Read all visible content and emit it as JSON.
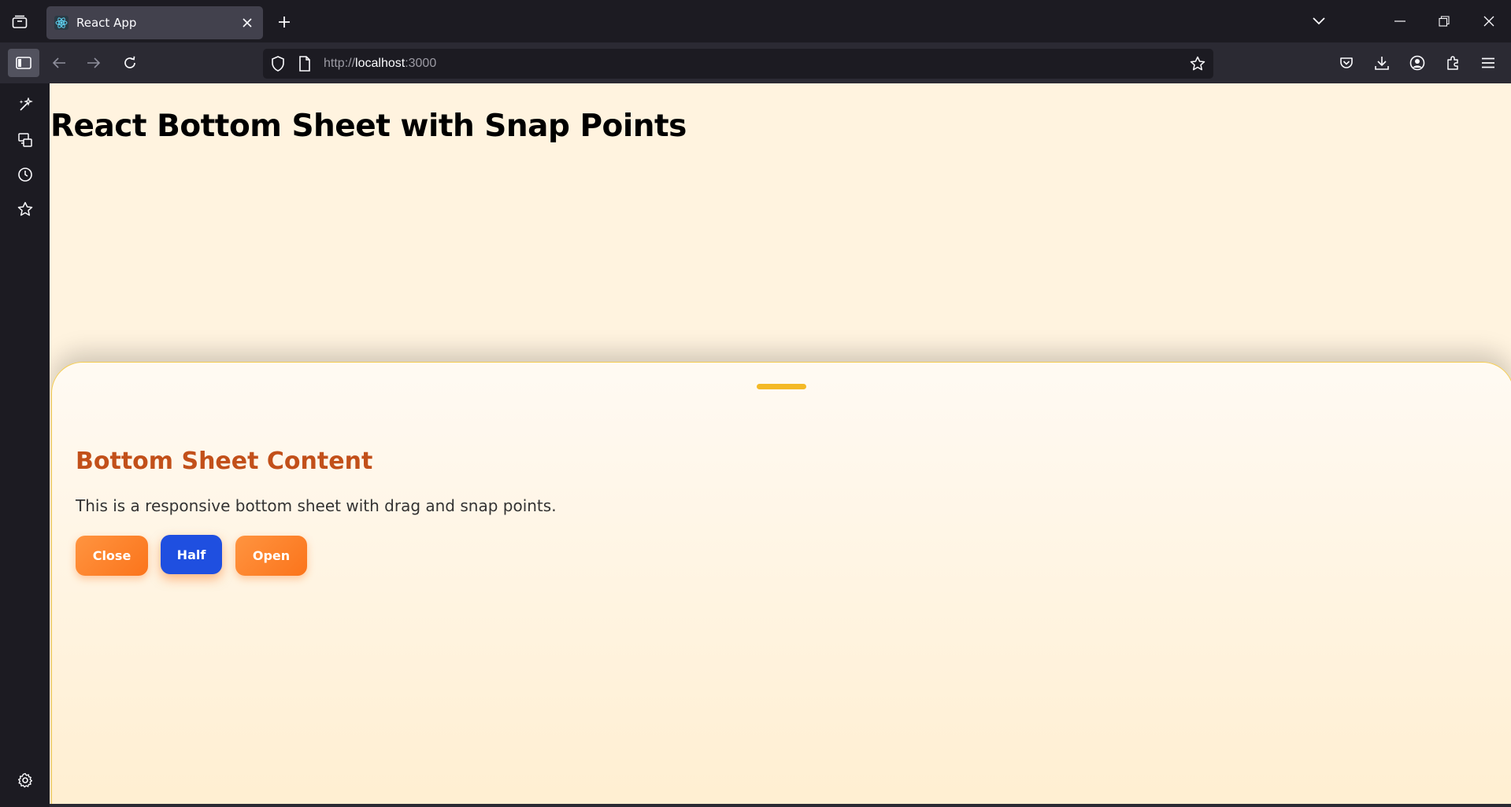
{
  "browser": {
    "tab": {
      "title": "React App"
    },
    "url": {
      "scheme": "http://",
      "host": "localhost",
      "port": ":3000"
    }
  },
  "page": {
    "title": "React Bottom Sheet with Snap Points"
  },
  "sheet": {
    "title": "Bottom Sheet Content",
    "description": "This is a responsive bottom sheet with drag and snap points.",
    "buttons": {
      "close": "Close",
      "half": "Half",
      "open": "Open"
    }
  },
  "colors": {
    "page_bg": "#fff3df",
    "sheet_title": "#c2501a",
    "button_orange": "#fb741b",
    "button_active": "#1f4fe0",
    "handle": "#f4b927"
  }
}
